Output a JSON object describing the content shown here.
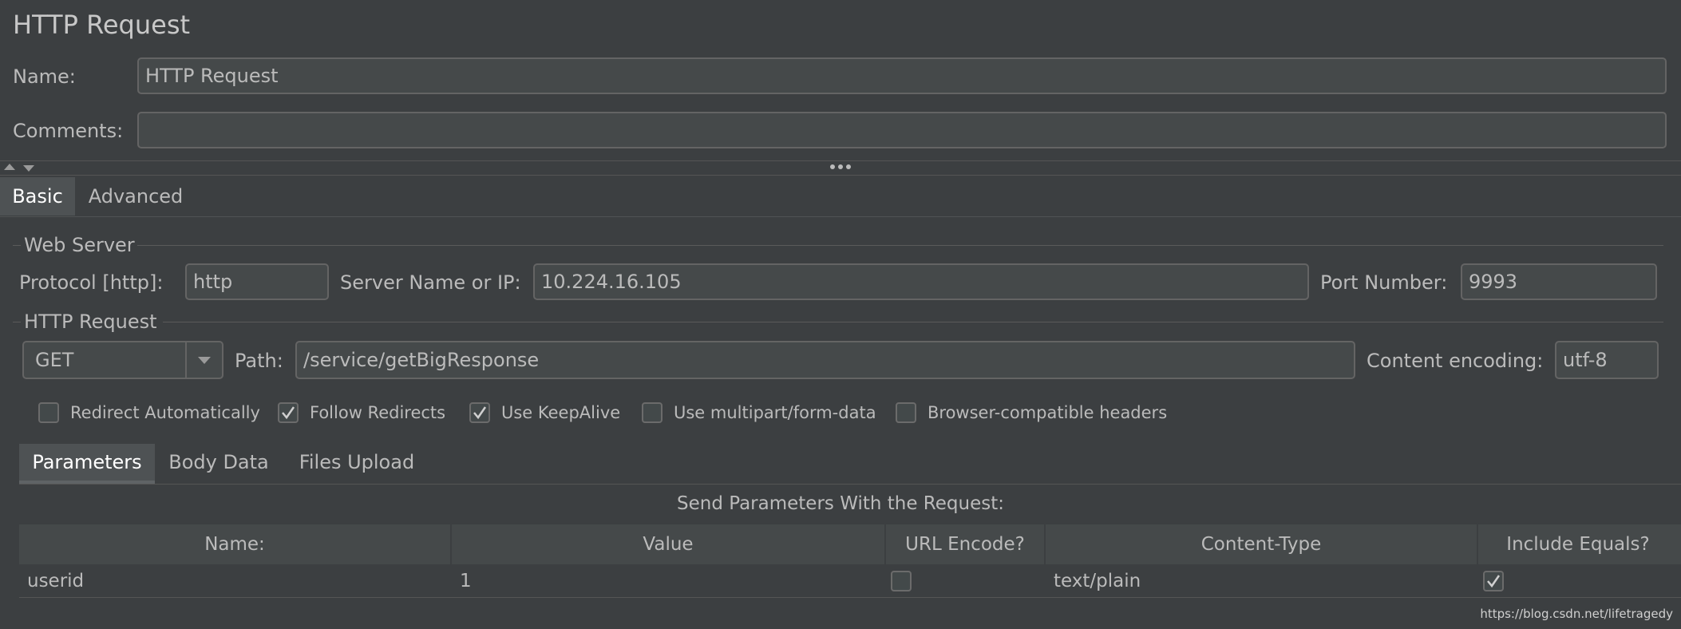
{
  "header": {
    "title": "HTTP Request"
  },
  "name_field": {
    "label": "Name:",
    "value": "HTTP Request"
  },
  "comments_field": {
    "label": "Comments:",
    "value": ""
  },
  "tabs": [
    {
      "label": "Basic",
      "selected": true
    },
    {
      "label": "Advanced",
      "selected": false
    }
  ],
  "web_server": {
    "group_title": "Web Server",
    "protocol_label": "Protocol [http]:",
    "protocol_value": "http",
    "server_label": "Server Name or IP:",
    "server_value": "10.224.16.105",
    "port_label": "Port Number:",
    "port_value": "9993"
  },
  "http_request": {
    "group_title": "HTTP Request",
    "method": "GET",
    "path_label": "Path:",
    "path_value": "/service/getBigResponse",
    "encoding_label": "Content encoding:",
    "encoding_value": "utf-8"
  },
  "options": [
    {
      "label": "Redirect Automatically",
      "checked": false
    },
    {
      "label": "Follow Redirects",
      "checked": true
    },
    {
      "label": "Use KeepAlive",
      "checked": true
    },
    {
      "label": "Use multipart/form-data",
      "checked": false
    },
    {
      "label": "Browser-compatible headers",
      "checked": false
    }
  ],
  "sub_tabs": [
    {
      "label": "Parameters",
      "selected": true
    },
    {
      "label": "Body Data",
      "selected": false
    },
    {
      "label": "Files Upload",
      "selected": false
    }
  ],
  "parameters": {
    "caption": "Send Parameters With the Request:",
    "columns": [
      "Name:",
      "Value",
      "URL Encode?",
      "Content-Type",
      "Include Equals?"
    ],
    "rows": [
      {
        "name": "userid",
        "value": "1",
        "url_encode": false,
        "content_type": "text/plain",
        "include_equals": true
      }
    ]
  },
  "watermark": "https://blog.csdn.net/lifetragedy",
  "colors": {
    "background": "#3c3f41",
    "field": "#45494a",
    "border": "#646464",
    "text": "#bbbbbb"
  }
}
